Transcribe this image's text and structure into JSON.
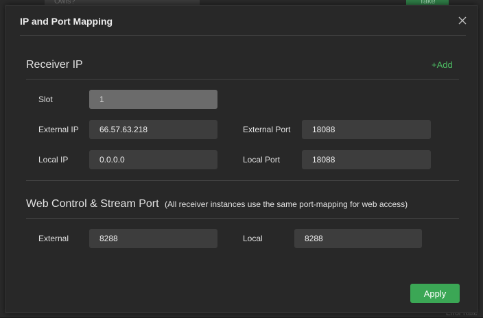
{
  "background": {
    "left_hint": "Owls?",
    "right_hint": "Take",
    "bottom_hint": "Error Rate"
  },
  "dialog": {
    "title": "IP and Port Mapping",
    "close_icon": "close-icon"
  },
  "receiver_ip": {
    "title": "Receiver IP",
    "add_label": "+Add",
    "slot_label": "Slot",
    "slot_value": "1",
    "external_ip_label": "External IP",
    "external_ip_value": "66.57.63.218",
    "external_port_label": "External Port",
    "external_port_value": "18088",
    "local_ip_label": "Local IP",
    "local_ip_value": "0.0.0.0",
    "local_port_label": "Local Port",
    "local_port_value": "18088"
  },
  "web_control": {
    "title": "Web Control & Stream Port",
    "note": "(All receiver instances use the same port-mapping for web access)",
    "external_label": "External",
    "external_value": "8288",
    "local_label": "Local",
    "local_value": "8288"
  },
  "footer": {
    "apply_label": "Apply"
  },
  "colors": {
    "accent": "#3ba755",
    "link": "#4cbb62",
    "dialog_bg": "#282828",
    "input_bg": "#3d3d3d"
  }
}
